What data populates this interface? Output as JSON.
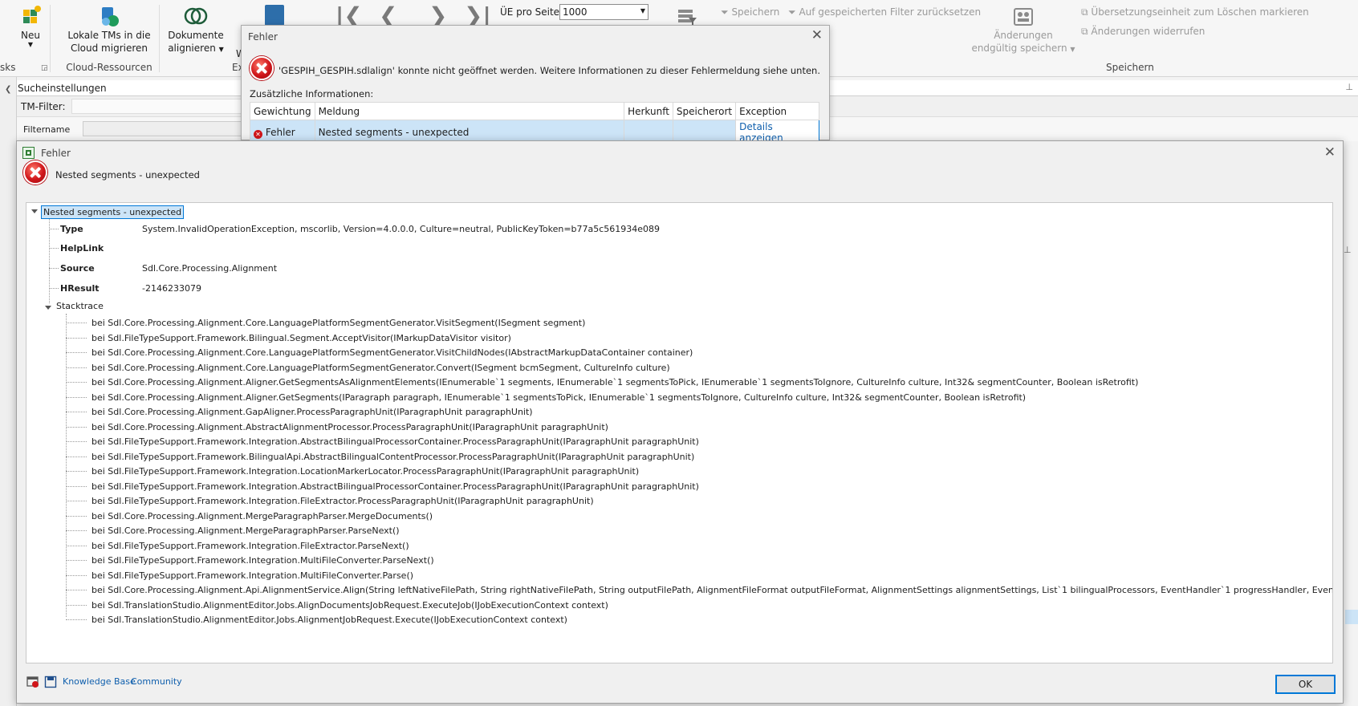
{
  "ribbon": {
    "neu_label": "Neu",
    "migrate_label_1": "Lokale TMs in die",
    "migrate_label_2": "Cloud migrieren",
    "cloud_group": "Cloud-Ressourcen",
    "tasks_group_fragment": "sks",
    "align_label_1": "Dokumente",
    "align_label_2": "alignieren",
    "align_group_fragment": "Ext",
    "w_fragment": "W",
    "ue_label": "ÜE pro Seite:",
    "ue_value": "1000",
    "save_filter": "Speichern",
    "reset_filter": "Auf gespeicherten Filter zurücksetzen",
    "commit_label_1": "Änderungen",
    "commit_label_2": "endgültig speichern",
    "mark_delete": "Übersetzungseinheit zum Löschen markieren",
    "undo_changes": "Änderungen widerrufen",
    "save_group": "Speichern"
  },
  "search": {
    "title": "Sucheinstellungen",
    "tm_filter_label": "TM-Filter:",
    "filtername_label": "Filtername"
  },
  "dialog1": {
    "title": "Fehler",
    "message": "'GESPIH_GESPIH.sdlalign' konnte nicht geöffnet werden. Weitere Informationen zu dieser Fehlermeldung siehe unten.",
    "additional_label": "Zusätzliche Informationen:",
    "columns": [
      "Gewichtung",
      "Meldung",
      "Herkunft",
      "Speicherort",
      "Exception"
    ],
    "row": {
      "gewichtung": "Fehler",
      "meldung": "Nested segments - unexpected",
      "herkunft": "",
      "speicherort": "",
      "exception": "Details anzeigen"
    }
  },
  "dialog2": {
    "title": "Fehler",
    "header_message": "Nested segments - unexpected",
    "root_node": "Nested segments - unexpected",
    "props": [
      {
        "key": "Type",
        "value": "System.InvalidOperationException, mscorlib, Version=4.0.0.0, Culture=neutral, PublicKeyToken=b77a5c561934e089"
      },
      {
        "key": "HelpLink",
        "value": ""
      },
      {
        "key": "Source",
        "value": "Sdl.Core.Processing.Alignment"
      },
      {
        "key": "HResult",
        "value": "-2146233079"
      }
    ],
    "stacktrace_label": "Stacktrace",
    "stacktrace": [
      "bei Sdl.Core.Processing.Alignment.Core.LanguagePlatformSegmentGenerator.VisitSegment(ISegment segment)",
      "bei Sdl.FileTypeSupport.Framework.Bilingual.Segment.AcceptVisitor(IMarkupDataVisitor visitor)",
      "bei Sdl.Core.Processing.Alignment.Core.LanguagePlatformSegmentGenerator.VisitChildNodes(IAbstractMarkupDataContainer container)",
      "bei Sdl.Core.Processing.Alignment.Core.LanguagePlatformSegmentGenerator.Convert(ISegment bcmSegment, CultureInfo culture)",
      "bei Sdl.Core.Processing.Alignment.Aligner.GetSegmentsAsAlignmentElements(IEnumerable`1 segments, IEnumerable`1 segmentsToPick, IEnumerable`1 segmentsToIgnore, CultureInfo culture, Int32& segmentCounter, Boolean isRetrofit)",
      "bei Sdl.Core.Processing.Alignment.Aligner.GetSegments(IParagraph paragraph, IEnumerable`1 segmentsToPick, IEnumerable`1 segmentsToIgnore, CultureInfo culture, Int32& segmentCounter, Boolean isRetrofit)",
      "bei Sdl.Core.Processing.Alignment.GapAligner.ProcessParagraphUnit(IParagraphUnit paragraphUnit)",
      "bei Sdl.Core.Processing.Alignment.AbstractAlignmentProcessor.ProcessParagraphUnit(IParagraphUnit paragraphUnit)",
      "bei Sdl.FileTypeSupport.Framework.Integration.AbstractBilingualProcessorContainer.ProcessParagraphUnit(IParagraphUnit paragraphUnit)",
      "bei Sdl.FileTypeSupport.Framework.BilingualApi.AbstractBilingualContentProcessor.ProcessParagraphUnit(IParagraphUnit paragraphUnit)",
      "bei Sdl.FileTypeSupport.Framework.Integration.LocationMarkerLocator.ProcessParagraphUnit(IParagraphUnit paragraphUnit)",
      "bei Sdl.FileTypeSupport.Framework.Integration.AbstractBilingualProcessorContainer.ProcessParagraphUnit(IParagraphUnit paragraphUnit)",
      "bei Sdl.FileTypeSupport.Framework.Integration.FileExtractor.ProcessParagraphUnit(IParagraphUnit paragraphUnit)",
      "bei Sdl.Core.Processing.Alignment.MergeParagraphParser.MergeDocuments()",
      "bei Sdl.Core.Processing.Alignment.MergeParagraphParser.ParseNext()",
      "bei Sdl.FileTypeSupport.Framework.Integration.FileExtractor.ParseNext()",
      "bei Sdl.FileTypeSupport.Framework.Integration.MultiFileConverter.ParseNext()",
      "bei Sdl.FileTypeSupport.Framework.Integration.MultiFileConverter.Parse()",
      "bei Sdl.Core.Processing.Alignment.Api.AlignmentService.Align(String leftNativeFilePath, String rightNativeFilePath, String outputFilePath, AlignmentFileFormat outputFileFormat, AlignmentSettings alignmentSettings, List`1 bilingualProcessors, EventHandler`1 progressHandler, EventHandler`1 messageReporter)",
      "bei Sdl.TranslationStudio.AlignmentEditor.Jobs.AlignDocumentsJobRequest.ExecuteJob(IJobExecutionContext context)",
      "bei Sdl.TranslationStudio.AlignmentEditor.Jobs.AlignmentJobRequest.Execute(IJobExecutionContext context)"
    ],
    "footer_links": {
      "knowledge_base": "Knowledge Base",
      "community": "Community"
    },
    "ok_label": "OK"
  },
  "colors": {
    "accent": "#0078d7",
    "error": "#d0161b",
    "selection": "#cce4f7",
    "link": "#0f5fad"
  }
}
